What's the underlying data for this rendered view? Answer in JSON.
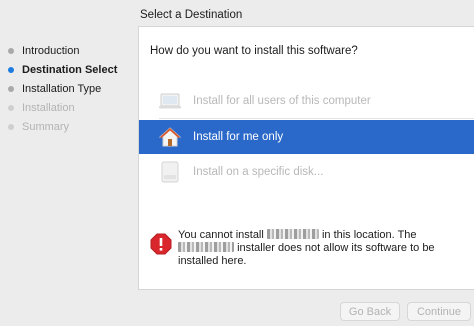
{
  "sidebar": {
    "steps": [
      {
        "label": "Introduction",
        "state": "done"
      },
      {
        "label": "Destination Select",
        "state": "active"
      },
      {
        "label": "Installation Type",
        "state": "pending"
      },
      {
        "label": "Installation",
        "state": "disabled"
      },
      {
        "label": "Summary",
        "state": "disabled"
      }
    ]
  },
  "main": {
    "title": "Select a Destination",
    "question": "How do you want to install this software?",
    "options": [
      {
        "label": "Install for all users of this computer",
        "icon": "computer-icon",
        "state": "disabled"
      },
      {
        "label": "Install for me only",
        "icon": "home-icon",
        "state": "selected"
      },
      {
        "label": "Install on a specific disk...",
        "icon": "disk-icon",
        "state": "disabled"
      }
    ],
    "message": {
      "icon": "warning-icon",
      "line1_start": "You cannot install ",
      "line1_end": " in this location.  The",
      "line2_end": "installer does not allow its software to be",
      "line3": "installed here."
    }
  },
  "buttons": {
    "back": "Go Back",
    "continue": "Continue"
  },
  "colors": {
    "selection": "#2a68c9",
    "active_dot": "#1e7ce0",
    "warning": "#d9262c"
  }
}
